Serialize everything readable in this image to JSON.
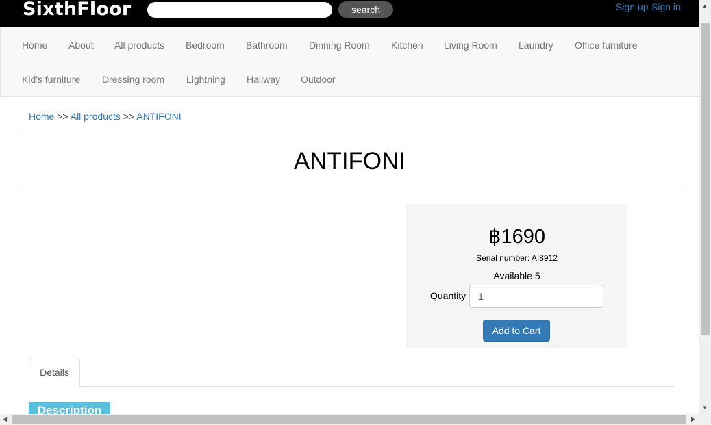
{
  "header": {
    "logo": "SixthFloor",
    "search_placeholder": "",
    "search_button": "search",
    "signup": "Sign up",
    "signin": "Sign in"
  },
  "nav": {
    "row1": [
      "Home",
      "About",
      "All products",
      "Bedroom",
      "Bathroom",
      "Dinning Room",
      "Kitchen",
      "Living Room",
      "Laundry",
      "Office furniture"
    ],
    "row2": [
      "Kid's furniture",
      "Dressing room",
      "Lightning",
      "Hallway",
      "Outdoor"
    ]
  },
  "breadcrumb": {
    "home": "Home",
    "sep1": ">>",
    "all_products": "All products",
    "sep2": ">>",
    "current": "ANTIFONI"
  },
  "product": {
    "title": "ANTIFONI",
    "price": "฿1690",
    "serial": "Serial number: AI8912",
    "available": "Available 5",
    "quantity_label": "Quantity",
    "quantity_value": "1",
    "add_to_cart": "Add to Cart"
  },
  "tabs": {
    "details": "Details",
    "description": "Description"
  },
  "scrollbar": {
    "up": "▲",
    "down": "▼",
    "left": "◀",
    "right": "▶"
  }
}
